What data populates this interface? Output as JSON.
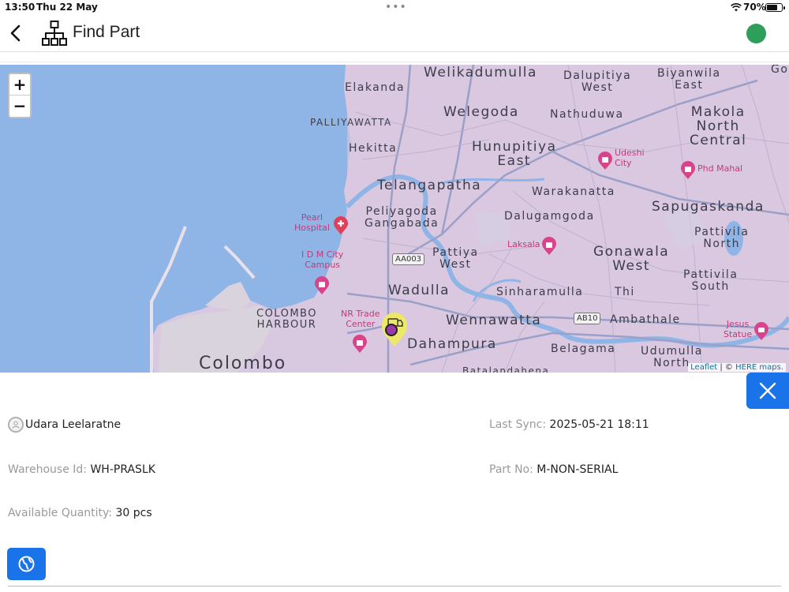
{
  "status_bar": {
    "time": "13:50",
    "date": "Thu 22 May",
    "dots": "•••",
    "battery": "70%"
  },
  "header": {
    "title": "Find Part",
    "status_color": "#2e9e5b"
  },
  "map": {
    "zoom_in": "+",
    "zoom_out": "−",
    "attribution_leaflet": "Leaflet",
    "attribution_sep": " | © ",
    "attribution_here": "HERE maps.",
    "places": {
      "welikadamulla": "Welikadumulla",
      "elakanda": "Elakanda",
      "dalupitiya_west": "Dalupitiya\nWest",
      "biyanwila_east": "Biyanwila\nEast",
      "go": "Go",
      "palliyawatta": "PALLIYAWATTA",
      "welegoda": "Welegoda",
      "nathuduwa": "Nathuduwa",
      "makola_north_central": "Makola\nNorth\nCentral",
      "hekitta": "Hekitta",
      "hunupitiya_east": "Hunupitiya\nEast",
      "telangapatha": "Telangapatha",
      "warakanatta": "Warakanatta",
      "peliyagoda_gangabada": "Peliyagoda\nGangabada",
      "dalugamgoda": "Dalugamgoda",
      "sapugaskanda": "Sapugaskanda",
      "pattivila_north": "Pattivila\nNorth",
      "pattiya_west": "Pattiya\nWest",
      "gonawala_west": "Gonawala\nWest",
      "pattivila_south": "Pattivila\nSouth",
      "wadulla": "Wadulla",
      "sinharamulla": "Sinharamulla",
      "thi": "Thi",
      "colombo_harbour": "COLOMBO\nHARBOUR",
      "wennawatta": "Wennawatta",
      "ambathale": "Ambathale",
      "dahampura": "Dahampura",
      "belagama": "Belagama",
      "udumulla_north": "Udumulla\nNorth",
      "colombo": "Colombo",
      "batalandahena": "Batalandahena"
    },
    "pois": {
      "udeshi_city": "Udeshi\nCity",
      "phd_mahal": "Phd Mahal",
      "pearl_hospital": "Pearl\nHospital",
      "idm_city_campus": "I D M City\nCampus",
      "laksala": "Laksala",
      "nr_trade_center": "NR Trade\nCenter",
      "jesus_statue": "Jesus\nStatue"
    },
    "roads": {
      "aa003": "AA003",
      "ab10": "AB10"
    },
    "colors": {
      "water": "#8fb5e6",
      "land": "#d9c9e0",
      "poi": "#d8448a",
      "marker": "#eee86a"
    }
  },
  "details": {
    "user_name": "Udara Leelaratne",
    "last_sync_label": "Last Sync:",
    "last_sync_value": "2025-05-21 18:11",
    "warehouse_label": "Warehouse Id:",
    "warehouse_value": "WH-PRASLK",
    "part_label": "Part No:",
    "part_value": "M-NON-SERIAL",
    "qty_label": "Available Quantity:",
    "qty_value": "30 pcs"
  }
}
